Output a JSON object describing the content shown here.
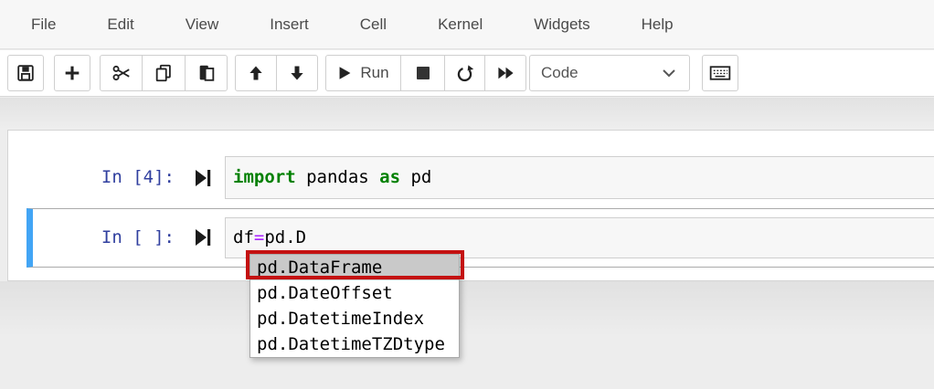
{
  "menubar": {
    "items": [
      "File",
      "Edit",
      "View",
      "Insert",
      "Cell",
      "Kernel",
      "Widgets",
      "Help"
    ]
  },
  "toolbar": {
    "run_label": "Run",
    "cell_type_selector": {
      "value": "Code"
    },
    "icons": [
      "save",
      "add-cell",
      "cut",
      "copy",
      "paste",
      "move-up",
      "move-down",
      "run",
      "stop",
      "restart",
      "fast-forward",
      "keyboard"
    ]
  },
  "cells": [
    {
      "prompt": "In [4]:",
      "tokens": [
        {
          "text": "import",
          "type": "keyword"
        },
        {
          "text": " pandas ",
          "type": "plain"
        },
        {
          "text": "as",
          "type": "keyword"
        },
        {
          "text": " pd",
          "type": "plain"
        }
      ]
    },
    {
      "prompt": "In [ ]:",
      "tokens": [
        {
          "text": "df",
          "type": "plain"
        },
        {
          "text": "=",
          "type": "operator"
        },
        {
          "text": "pd.D",
          "type": "plain"
        }
      ]
    }
  ],
  "completion_menu": {
    "items": [
      "pd.DataFrame",
      "pd.DateOffset",
      "pd.DatetimeIndex",
      "pd.DatetimeTZDtype"
    ],
    "selected": "pd.DataFrame",
    "selected_index": 0
  },
  "colors": {
    "prompt_blue": "#303F9F",
    "keyword_green": "#008000",
    "operator_purple": "#AA22FF",
    "selected_cell_bar": "#42A5F5",
    "annotation_red": "#C41111",
    "completion_selected_bg": "#C9C9C9"
  }
}
